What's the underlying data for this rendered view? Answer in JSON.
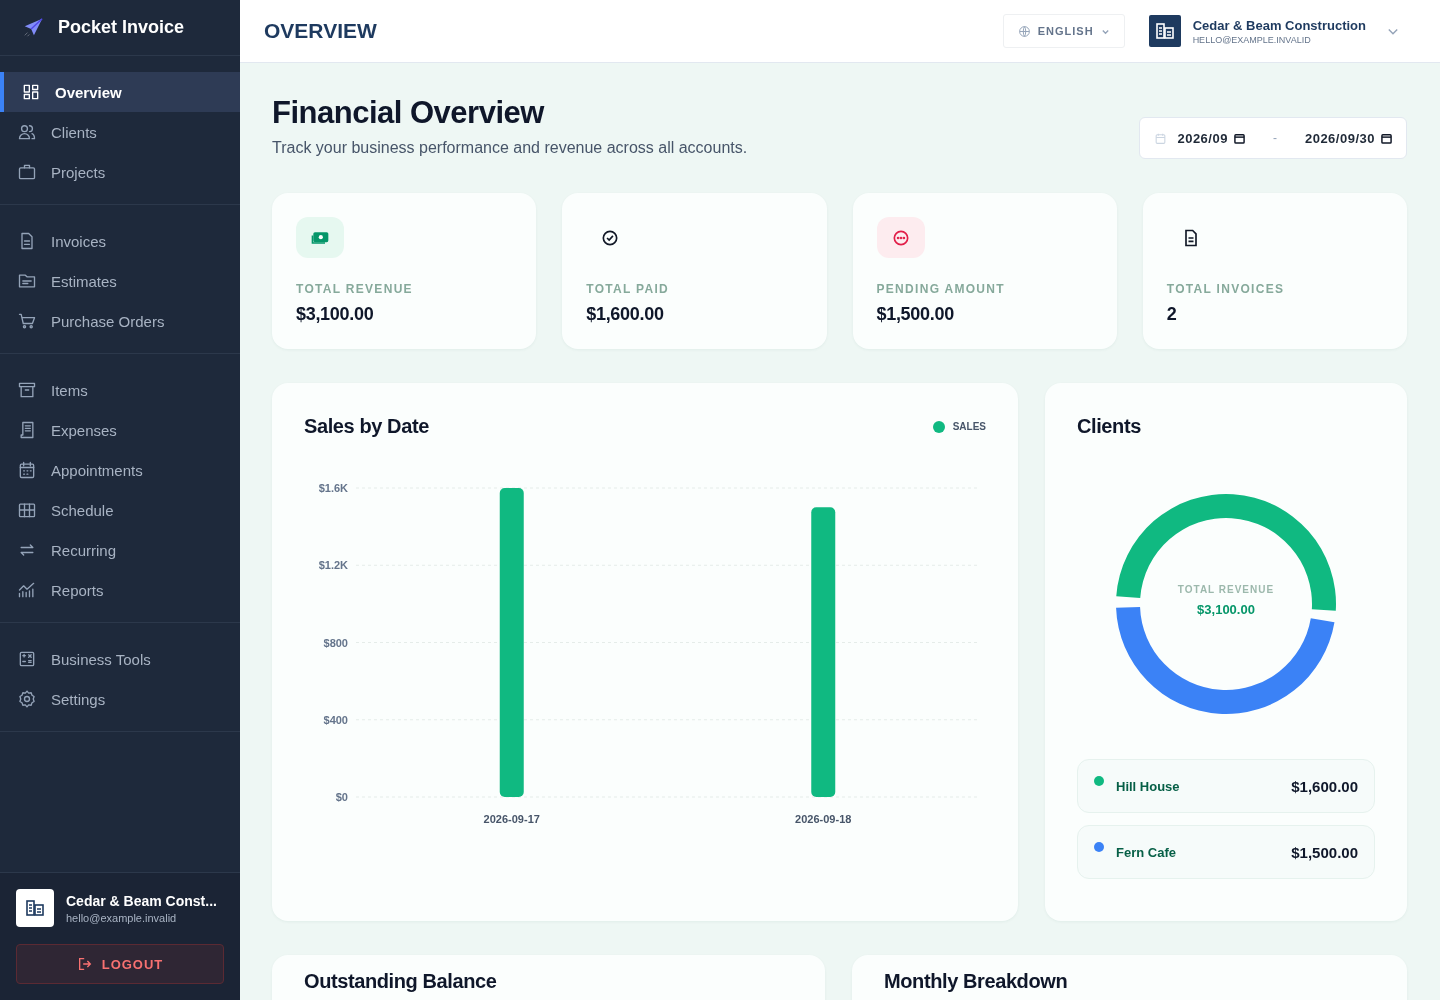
{
  "sidebar": {
    "brand": "Pocket Invoice",
    "groups": [
      [
        {
          "label": "Overview",
          "selected": true
        },
        {
          "label": "Clients",
          "selected": false
        },
        {
          "label": "Projects",
          "selected": false
        }
      ],
      [
        {
          "label": "Invoices",
          "selected": false
        },
        {
          "label": "Estimates",
          "selected": false
        },
        {
          "label": "Purchase Orders",
          "selected": false
        }
      ],
      [
        {
          "label": "Items",
          "selected": false
        },
        {
          "label": "Expenses",
          "selected": false
        },
        {
          "label": "Appointments",
          "selected": false
        },
        {
          "label": "Schedule",
          "selected": false
        },
        {
          "label": "Recurring",
          "selected": false
        },
        {
          "label": "Reports",
          "selected": false
        }
      ],
      [
        {
          "label": "Business Tools",
          "selected": false
        },
        {
          "label": "Settings",
          "selected": false
        }
      ]
    ],
    "account": {
      "name": "Cedar & Beam Const...",
      "email": "hello@example.invalid"
    },
    "logout": "LOGOUT"
  },
  "header": {
    "title": "OVERVIEW",
    "language": "ENGLISH",
    "account_name": "Cedar & Beam Construction",
    "account_email": "HELLO@EXAMPLE.INVALID"
  },
  "page": {
    "title": "Financial Overview",
    "subtitle": "Track your business performance and revenue across all accounts.",
    "date_from": "2026/09",
    "date_separator": "-",
    "date_to": "2026/09/30"
  },
  "stats": [
    {
      "label": "TOTAL REVENUE",
      "value": "$3,100.00"
    },
    {
      "label": "TOTAL PAID",
      "value": "$1,600.00"
    },
    {
      "label": "PENDING AMOUNT",
      "value": "$1,500.00"
    },
    {
      "label": "TOTAL INVOICES",
      "value": "2"
    }
  ],
  "sales": {
    "title": "Sales by Date",
    "chart_data": {
      "type": "bar",
      "categories": [
        "2026-09-17",
        "2026-09-18"
      ],
      "series": [
        {
          "name": "SALES",
          "color": "#10b981",
          "values": [
            1600,
            1500
          ]
        }
      ],
      "grid": true,
      "ylim": [
        0,
        1600
      ],
      "yticks": [
        {
          "value": 0,
          "label": "$0"
        },
        {
          "value": 400,
          "label": "$400"
        },
        {
          "value": 800,
          "label": "$800"
        },
        {
          "value": 1200,
          "label": "$1.2K"
        },
        {
          "value": 1600,
          "label": "$1.6K"
        }
      ]
    }
  },
  "clients": {
    "title": "Clients",
    "center_label": "TOTAL REVENUE",
    "center_value": "$3,100.00",
    "chart_data": {
      "type": "donut",
      "categories": [
        "Hill House",
        "Fern Cafe"
      ],
      "values": [
        51.6,
        48.4
      ]
    },
    "rows": [
      {
        "amount": "$1,600.00",
        "color": "#10b981"
      },
      {
        "amount": "$1,500.00",
        "color": "#3b82f6"
      }
    ]
  },
  "bottom_cards": [
    {
      "title": "Outstanding Balance"
    },
    {
      "title": "Monthly Breakdown"
    }
  ]
}
